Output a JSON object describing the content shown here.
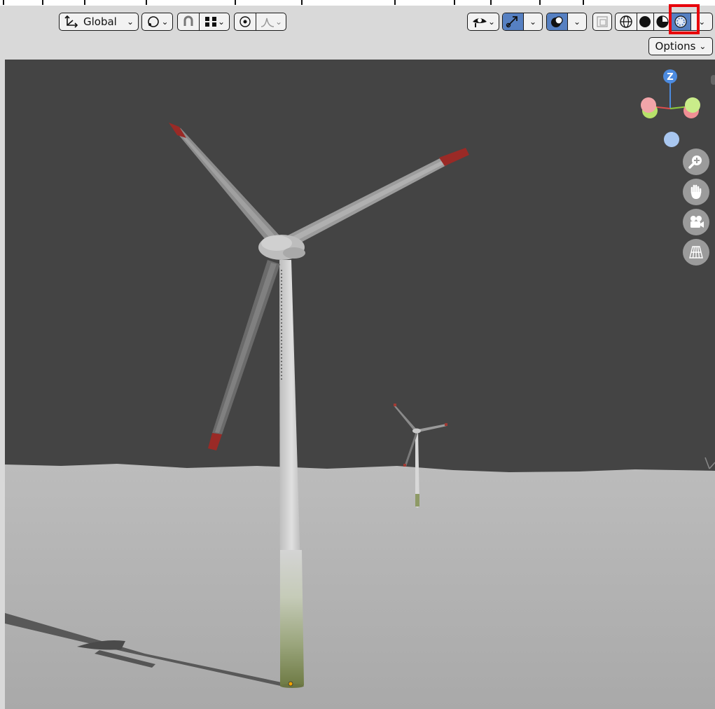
{
  "header": {
    "transform_orientation": "Global",
    "options_label": "Options"
  },
  "navigation_gizmo": {
    "z_axis_label": "Z"
  },
  "colors": {
    "active_button": "#5680c2",
    "highlight_box": "#e8000b",
    "sky": "#444444",
    "ground": "#b5b5b5",
    "blade_tip": "#9a2a26"
  },
  "icons": {
    "orientation": "transform-orientation-icon",
    "pivot": "pivot-point-icon",
    "snap": "snap-magnet-icon",
    "snap_target": "snap-increment-icon",
    "proportional": "proportional-editing-icon",
    "falloff": "falloff-curve-icon",
    "visibility": "object-visibility-icon",
    "gizmo": "gizmo-icon",
    "overlays": "overlays-icon",
    "xray": "xray-icon",
    "wireframe": "wireframe-shading-icon",
    "solid": "solid-shading-icon",
    "material": "material-preview-icon",
    "rendered": "rendered-shading-icon",
    "zoom": "zoom-icon",
    "pan": "pan-hand-icon",
    "camera": "camera-view-icon",
    "perspective": "perspective-grid-icon"
  }
}
